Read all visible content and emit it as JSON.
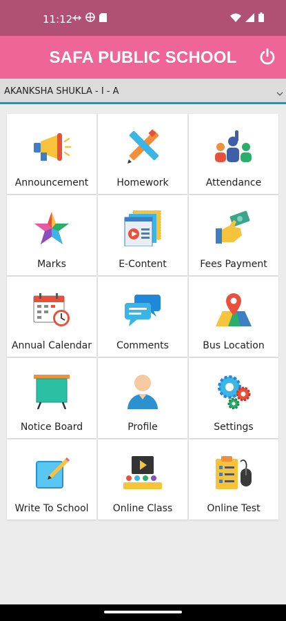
{
  "status_bar": {
    "time": "11:12",
    "left_icons": [
      "usb-debug-icon",
      "vpn-icon",
      "sd-card-icon"
    ],
    "right_icons": [
      "wifi-icon",
      "signal-icon",
      "battery-icon"
    ]
  },
  "app_bar": {
    "title": "SAFA PUBLIC SCHOOL",
    "power_icon": "power-icon"
  },
  "student_selector": {
    "selected": "AKANKSHA SHUKLA - I - A"
  },
  "menu": {
    "items": [
      {
        "label": "Announcement",
        "icon": "megaphone-icon"
      },
      {
        "label": "Homework",
        "icon": "pencil-ruler-icon"
      },
      {
        "label": "Attendance",
        "icon": "raised-hand-group-icon"
      },
      {
        "label": "Marks",
        "icon": "star-icon"
      },
      {
        "label": "E-Content",
        "icon": "video-book-icon"
      },
      {
        "label": "Fees Payment",
        "icon": "hand-money-icon"
      },
      {
        "label": "Annual Calendar",
        "icon": "calendar-clock-icon"
      },
      {
        "label": "Comments",
        "icon": "chat-bubbles-icon"
      },
      {
        "label": "Bus Location",
        "icon": "map-pin-icon"
      },
      {
        "label": "Notice Board",
        "icon": "notice-board-icon"
      },
      {
        "label": "Profile",
        "icon": "user-profile-icon"
      },
      {
        "label": "Settings",
        "icon": "gears-icon"
      },
      {
        "label": "Write To School",
        "icon": "write-note-icon"
      },
      {
        "label": "Online Class",
        "icon": "online-class-icon"
      },
      {
        "label": "Online Test",
        "icon": "test-mouse-icon"
      }
    ]
  },
  "colors": {
    "status_bar": "#b05074",
    "app_bar": "#f06598",
    "selector_underline": "#3a8b9b",
    "background": "#ececec"
  }
}
